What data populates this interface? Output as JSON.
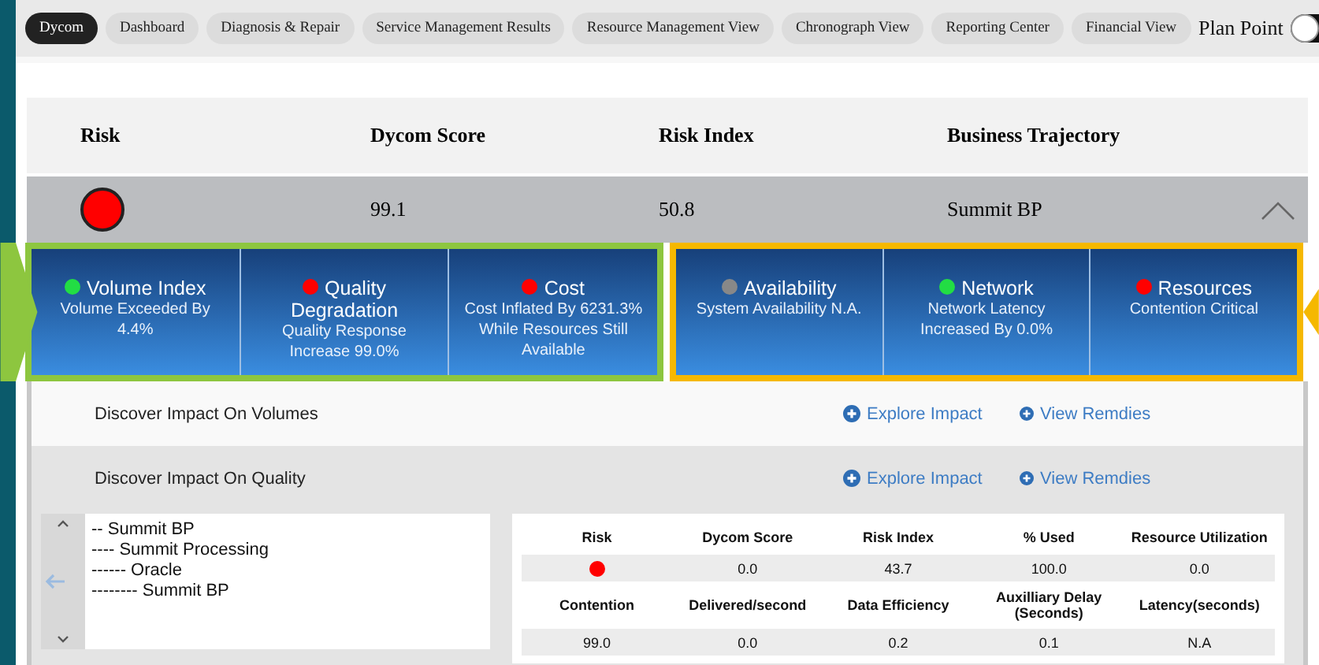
{
  "tabs": [
    {
      "label": "Dycom",
      "selected": true
    },
    {
      "label": "Dashboard",
      "selected": false
    },
    {
      "label": "Diagnosis & Repair",
      "selected": false
    },
    {
      "label": "Service Management Results",
      "selected": false
    },
    {
      "label": "Resource Management View",
      "selected": false
    },
    {
      "label": "Chronograph View",
      "selected": false
    },
    {
      "label": "Reporting Center",
      "selected": false
    },
    {
      "label": "Financial View",
      "selected": false
    }
  ],
  "plan_point": {
    "label": "Plan Point",
    "on": false
  },
  "summary": {
    "columns": [
      "Risk",
      "Dycom Score",
      "Risk Index",
      "Business Trajectory"
    ],
    "row": {
      "color": "#ff0000",
      "dycom_score": "99.1",
      "risk_index": "50.8",
      "trajectory": "Summit BP",
      "expanded": true
    }
  },
  "kpi_groups": [
    {
      "color": "#8dc63f",
      "items": [
        {
          "title": "Volume Index",
          "detail": "Volume Exceeded By 4.4%",
          "color": "#22dd44"
        },
        {
          "title": "Quality Degradation",
          "detail": "Quality Response Increase 99.0%",
          "color": "#ff0000"
        },
        {
          "title": "Cost",
          "detail": "Cost Inflated By 6231.3% While Resources Still Available",
          "color": "#ff0000"
        }
      ]
    },
    {
      "color": "#f5b800",
      "items": [
        {
          "title": "Availability",
          "detail": "System Availability N.A.",
          "color": "#888888"
        },
        {
          "title": "Network",
          "detail": "Network Latency Increased By 0.0%",
          "color": "#22dd44"
        },
        {
          "title": "Resources",
          "detail": "Contention Critical",
          "color": "#ff0000"
        }
      ]
    }
  ],
  "impacts": [
    {
      "label": "Discover Impact On Volumes",
      "explore": "Explore Impact",
      "remedies": "View Remdies"
    },
    {
      "label": "Discover Impact On Quality",
      "explore": "Explore Impact",
      "remedies": "View Remdies"
    }
  ],
  "tree": [
    {
      "label": "-- Summit BP",
      "children": [
        {
          "label": "---- Summit Processing",
          "children": [
            {
              "label": "------ Oracle",
              "children": [
                {
                  "label": "-------- Summit BP"
                }
              ]
            }
          ]
        }
      ]
    }
  ],
  "details": {
    "rows": [
      {
        "kind": "header",
        "cells": [
          {
            "text": "Risk"
          },
          {
            "text": "Dycom Score"
          },
          {
            "text": "Risk Index"
          },
          {
            "text": "% Used"
          },
          {
            "text": "Resource Utilization"
          }
        ]
      },
      {
        "kind": "value",
        "cells": [
          {
            "color": "#ff0000"
          },
          {
            "text": "0.0"
          },
          {
            "text": "43.7"
          },
          {
            "text": "100.0"
          },
          {
            "text": "0.0"
          }
        ]
      },
      {
        "kind": "header",
        "cells": [
          {
            "text": "Contention"
          },
          {
            "text": "Delivered/second"
          },
          {
            "text": "Data Efficiency"
          },
          {
            "text": "Auxilliary Delay (Seconds)"
          },
          {
            "text": "Latency(seconds)"
          }
        ]
      },
      {
        "kind": "value",
        "cells": [
          {
            "text": "99.0"
          },
          {
            "text": "0.0"
          },
          {
            "text": "0.2"
          },
          {
            "text": "0.1"
          },
          {
            "text": "N.A"
          }
        ]
      }
    ]
  }
}
